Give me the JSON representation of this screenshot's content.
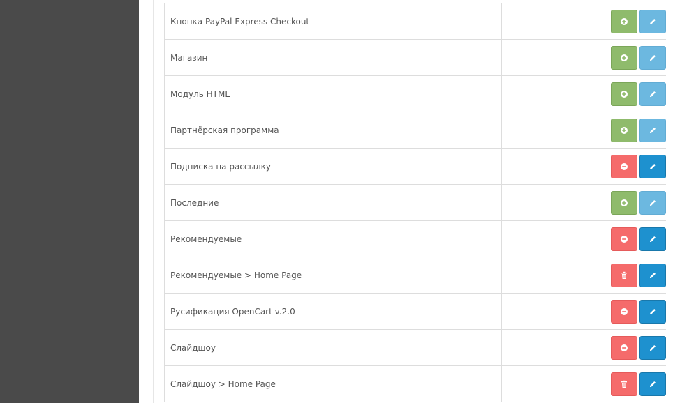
{
  "extensions": [
    {
      "name": "Кнопка PayPal Express Checkout",
      "status": "not_installed",
      "left_icon": "plus-circle-icon",
      "edit_enabled": false
    },
    {
      "name": "Магазин",
      "status": "not_installed",
      "left_icon": "plus-circle-icon",
      "edit_enabled": false
    },
    {
      "name": "Модуль HTML",
      "status": "not_installed",
      "left_icon": "plus-circle-icon",
      "edit_enabled": false
    },
    {
      "name": "Партнёрская программа",
      "status": "not_installed",
      "left_icon": "plus-circle-icon",
      "edit_enabled": false
    },
    {
      "name": "Подписка на рассылку",
      "status": "installed",
      "left_icon": "minus-circle-icon",
      "edit_enabled": true
    },
    {
      "name": "Последние",
      "status": "not_installed",
      "left_icon": "plus-circle-icon",
      "edit_enabled": false
    },
    {
      "name": "Рекомендуемые",
      "status": "installed",
      "left_icon": "minus-circle-icon",
      "edit_enabled": true
    },
    {
      "name": "Рекомендуемые > Home Page",
      "status": "instance",
      "left_icon": "trash-icon",
      "edit_enabled": true
    },
    {
      "name": "Русификация OpenCart v.2.0",
      "status": "installed",
      "left_icon": "minus-circle-icon",
      "edit_enabled": true
    },
    {
      "name": "Слайдшоу",
      "status": "installed",
      "left_icon": "minus-circle-icon",
      "edit_enabled": true
    },
    {
      "name": "Слайдшоу > Home Page",
      "status": "instance",
      "left_icon": "trash-icon",
      "edit_enabled": true
    }
  ],
  "colors": {
    "sidebar": "#4a4a4a",
    "install": "#8fbb6c",
    "uninstall": "#f56b6b",
    "edit": "#1e91cf",
    "edit_disabled": "#6cb8e0"
  }
}
